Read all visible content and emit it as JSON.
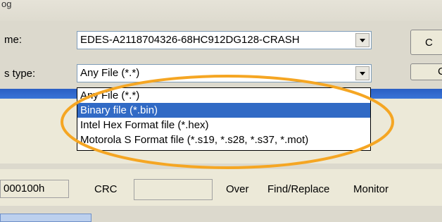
{
  "top_fragment": "og",
  "filename": {
    "label": "me:",
    "value": "EDES-A2118704326-68HC912DG128-CRASH"
  },
  "filetype": {
    "label": "s type:",
    "value": "Any File (*.*)",
    "options": [
      "Any File (*.*)",
      "Binary file (*.bin)",
      "Intel Hex Format file (*.hex)",
      "Motorola S Format file (*.s19, *.s28, *.s37, *.mot)"
    ],
    "selected_index": 1
  },
  "right_buttons": {
    "top": "C",
    "bottom": "C"
  },
  "bottom": {
    "address": "000100h",
    "crc_label": "CRC",
    "crc_value": "",
    "over_label": "Over",
    "find_replace_label": "Find/Replace",
    "monitor_label": "Monitor"
  },
  "colors": {
    "highlight_ellipse": "#f5a623",
    "selection": "#316ac5",
    "title_band": "#2a5fc4"
  }
}
